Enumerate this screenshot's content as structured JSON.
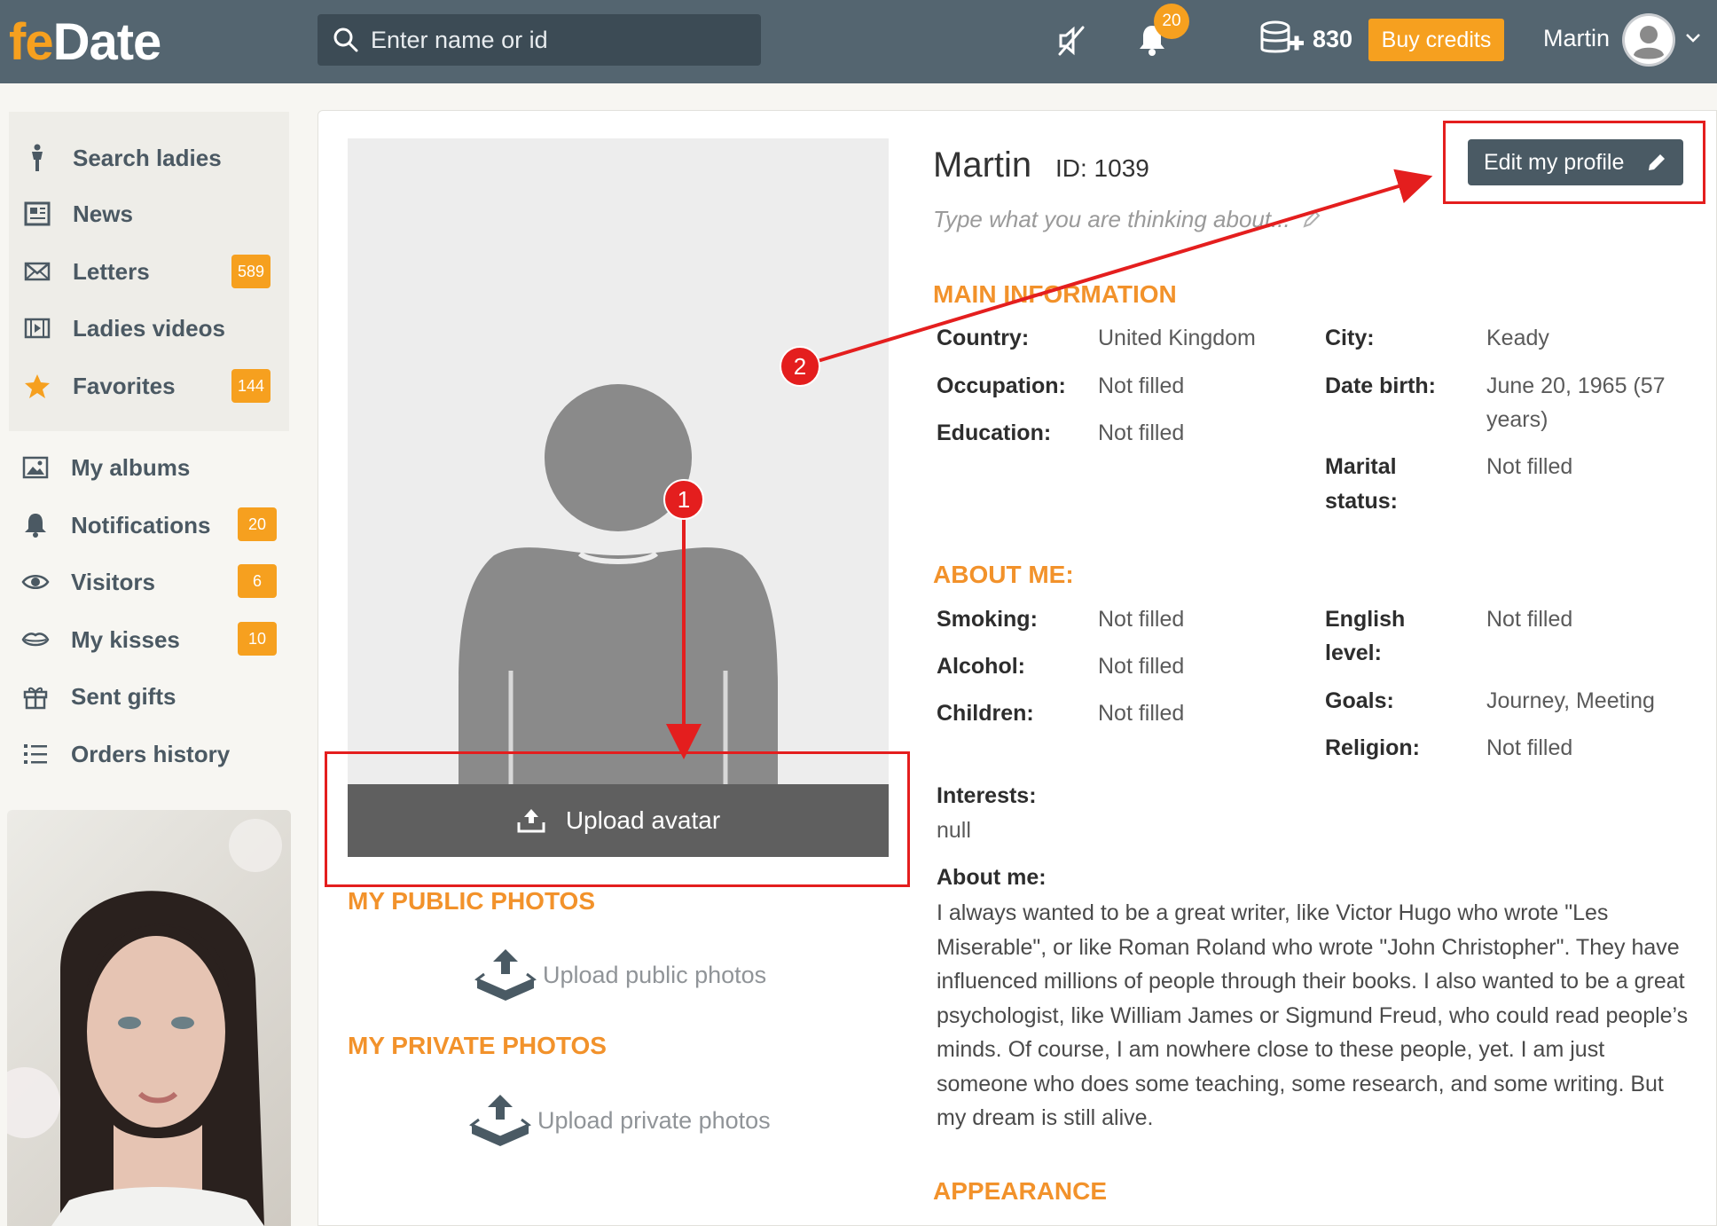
{
  "header": {
    "logo_fe": "fe",
    "logo_date": "Date",
    "search_placeholder": "Enter name or id",
    "notifications_count": "20",
    "credits": "830",
    "buy_credits": "Buy credits",
    "user_name": "Martin"
  },
  "sidebar": {
    "items": [
      {
        "label": "Search ladies",
        "icon": "person-icon"
      },
      {
        "label": "News",
        "icon": "newspaper-icon"
      },
      {
        "label": "Letters",
        "icon": "envelope-icon",
        "badge": "589"
      },
      {
        "label": "Ladies videos",
        "icon": "film-icon"
      },
      {
        "label": "Favorites",
        "icon": "star-icon",
        "badge": "144"
      },
      {
        "label": "My albums",
        "icon": "image-icon"
      },
      {
        "label": "Notifications",
        "icon": "bell-icon",
        "badge": "20"
      },
      {
        "label": "Visitors",
        "icon": "eye-icon",
        "badge": "6"
      },
      {
        "label": "My kisses",
        "icon": "lips-icon",
        "badge": "10"
      },
      {
        "label": "Sent gifts",
        "icon": "gift-icon"
      },
      {
        "label": "Orders history",
        "icon": "list-icon"
      }
    ]
  },
  "profile": {
    "name": "Martin",
    "id": "ID: 1039",
    "status_placeholder": "Type what you are thinking about...",
    "edit_button": "Edit my profile",
    "upload_avatar": "Upload avatar",
    "public_photos_title": "MY PUBLIC PHOTOS",
    "upload_public": "Upload public photos",
    "private_photos_title": "MY PRIVATE PHOTOS",
    "upload_private": "Upload private photos"
  },
  "main_info": {
    "title": "MAIN INFORMATION",
    "country_label": "Country:",
    "country": "United Kingdom",
    "occupation_label": "Occupation:",
    "occupation": "Not filled",
    "education_label": "Education:",
    "education": "Not filled",
    "city_label": "City:",
    "city": "Keady",
    "birth_label": "Date birth:",
    "birth_line1": "June 20, 1965 (57",
    "birth_line2": "years)",
    "marital_label_1": "Marital",
    "marital_label_2": "status:",
    "marital": "Not filled"
  },
  "about": {
    "title": "ABOUT ME:",
    "smoking_label": "Smoking:",
    "smoking": "Not filled",
    "alcohol_label": "Alcohol:",
    "alcohol": "Not filled",
    "children_label": "Children:",
    "children": "Not filled",
    "english_label_1": "English",
    "english_label_2": "level:",
    "english": "Not filled",
    "goals_label": "Goals:",
    "goals": "Journey, Meeting",
    "religion_label": "Religion:",
    "religion": "Not filled",
    "interests_label": "Interests:",
    "interests": "null",
    "about_label": "About me:",
    "about_text": "I always wanted to be a great writer, like Victor Hugo who wrote \"Les Miserable\", or like Roman Roland who wrote \"John Christopher\". They have influenced millions of people through their books. I also wanted to be a great psychologist, like William James or Sigmund Freud, who could read people’s minds. Of course, I am nowhere close to these people, yet. I am just someone who does some teaching, some research, and some writing. But my dream is still alive."
  },
  "appearance_title": "APPEARANCE",
  "annotations": {
    "marker_1": "1",
    "marker_2": "2"
  },
  "colors": {
    "header": "#546570",
    "accent": "#f6a01f",
    "section_title": "#f2922b",
    "annotation": "#e41e1e"
  }
}
